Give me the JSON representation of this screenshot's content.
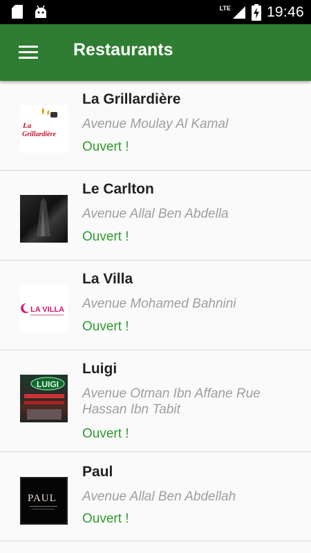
{
  "status_bar": {
    "time": "19:46",
    "network": "LTE",
    "icons": [
      "sd-card-icon",
      "android-icon",
      "signal-icon",
      "battery-charging-icon"
    ]
  },
  "app_bar": {
    "title": "Restaurants",
    "menu_icon": "menu-icon"
  },
  "colors": {
    "primary": "#2e7d32",
    "open_status": "#2e9a2e",
    "address": "#9e9e9e"
  },
  "restaurants": [
    {
      "name": "La Grillardière",
      "address": "Avenue Moulay Al Kamal",
      "status": "Ouvert !",
      "logo_text": "La Grillardière"
    },
    {
      "name": "Le Carlton",
      "address": "Avenue Allal Ben Abdella",
      "status": "Ouvert !",
      "logo_text": ""
    },
    {
      "name": "La Villa",
      "address": "Avenue Mohamed Bahnini",
      "status": "Ouvert !",
      "logo_text": "LA VILLA"
    },
    {
      "name": "Luigi",
      "address": "Avenue Otman Ibn Affane Rue Hassan Ibn Tabit",
      "status": "Ouvert !",
      "logo_text": "LUIGI"
    },
    {
      "name": "Paul",
      "address": "Avenue Allal Ben Abdellah",
      "status": "Ouvert !",
      "logo_text": "PAUL"
    }
  ]
}
